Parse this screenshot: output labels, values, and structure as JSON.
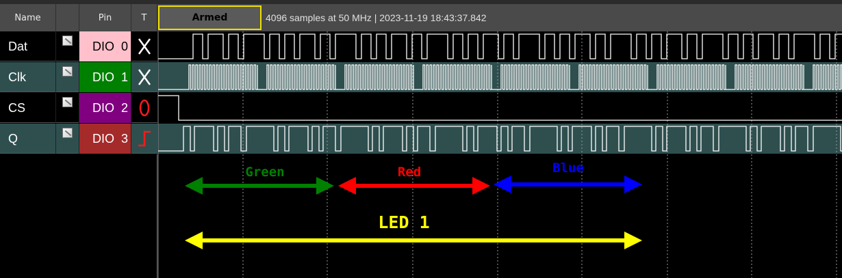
{
  "header": {
    "col_name": "Name",
    "col_pin": "Pin",
    "col_trigger": "T",
    "status": "Armed",
    "info": "4096 samples at 50 MHz | 2023-11-19 18:43:37.842"
  },
  "channels": [
    {
      "name": "Dat",
      "pin_label": "DIO",
      "pin_num": "0",
      "pin_color": "#ffc0cb",
      "text_color": "#000000",
      "row_bg": "#000000",
      "trigger": "x-icon"
    },
    {
      "name": "Clk",
      "pin_label": "DIO",
      "pin_num": "1",
      "pin_color": "#008000",
      "text_color": "#ffffff",
      "row_bg": "#2f4f4f",
      "trigger": "x-icon"
    },
    {
      "name": "CS",
      "pin_label": "DIO",
      "pin_num": "2",
      "pin_color": "#800080",
      "text_color": "#ffffff",
      "row_bg": "#000000",
      "trigger": "low-level-icon"
    },
    {
      "name": "Q",
      "pin_label": "DIO",
      "pin_num": "3",
      "pin_color": "#a52a2a",
      "text_color": "#ffffff",
      "row_bg": "#2f4f4f",
      "trigger": "rising-edge-icon"
    }
  ],
  "annotations": {
    "green": {
      "label": "Green",
      "color": "#008000"
    },
    "red": {
      "label": "Red",
      "color": "#ff0000"
    },
    "blue": {
      "label": "Blue",
      "color": "#0000ff"
    },
    "led": {
      "label": "LED 1",
      "color": "#ffff00"
    }
  }
}
